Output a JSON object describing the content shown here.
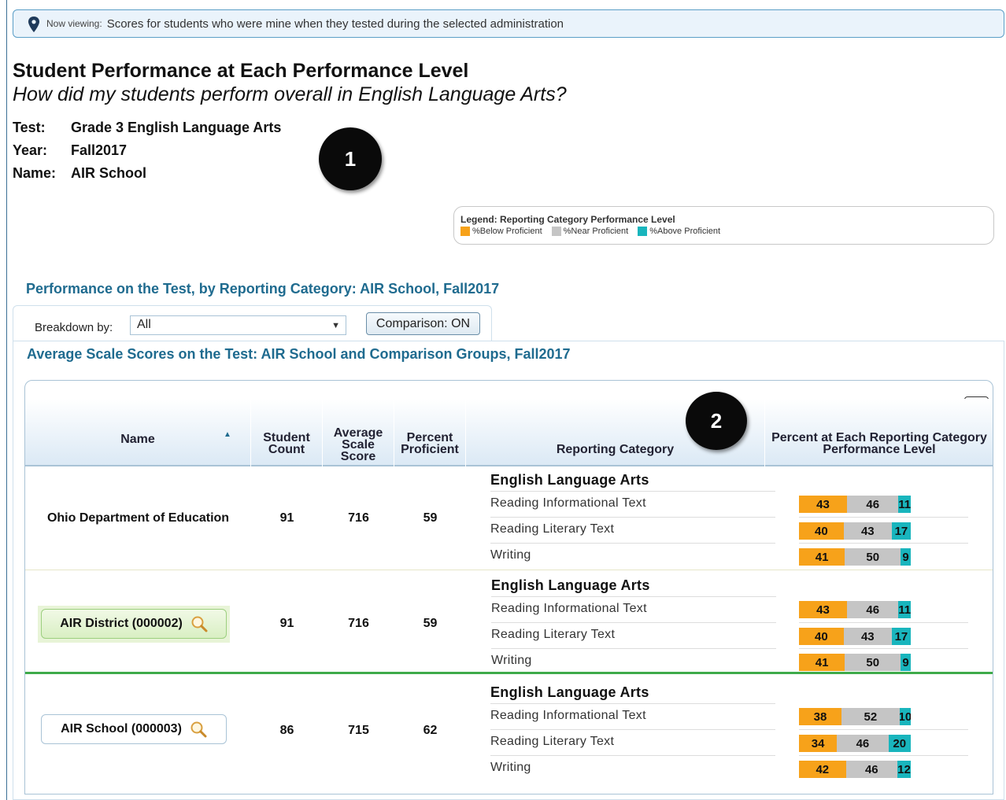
{
  "banner": {
    "label": "Now viewing:",
    "text": "Scores for students who were mine when they tested during the selected administration"
  },
  "report": {
    "title": "Student Performance at Each Performance Level",
    "subtitle": "How did my students perform overall in English Language Arts?",
    "meta": [
      {
        "key": "Test:",
        "value": "Grade 3 English Language Arts"
      },
      {
        "key": "Year:",
        "value": "Fall2017"
      },
      {
        "key": "Name:",
        "value": "AIR School"
      }
    ]
  },
  "callouts": {
    "one": "1",
    "two": "2"
  },
  "legend": {
    "title": "Legend: Reporting Category Performance Level",
    "items": [
      {
        "label": "%Below Proficient",
        "color": "#f7a21a"
      },
      {
        "label": "%Near Proficient",
        "color": "#c5c5c5"
      },
      {
        "label": "%Above Proficient",
        "color": "#19b5bd"
      }
    ]
  },
  "section1": {
    "title": "Performance on the Test, by Reporting Category: AIR School, Fall2017"
  },
  "controls": {
    "breakdown_label": "Breakdown by:",
    "breakdown_value": "All",
    "comparison_button": "Comparison: ON"
  },
  "section2": {
    "title": "Average Scale Scores on the Test: AIR School and Comparison Groups, Fall2017"
  },
  "table": {
    "headers": {
      "name": "Name",
      "count": "Student Count",
      "avg": "Average Scale Score",
      "pct": "Percent Proficient",
      "rc": "Reporting Category",
      "pl": "Percent at Each Reporting Category Performance Level"
    },
    "rows": [
      {
        "name": "Ohio Department of Education",
        "count": "91",
        "avg": "716",
        "pct": "59",
        "subject": "English Language Arts",
        "categories": [
          {
            "label": "Reading Informational Text",
            "below": 43,
            "near": 46,
            "above": 11
          },
          {
            "label": "Reading Literary Text",
            "below": 40,
            "near": 43,
            "above": 17
          },
          {
            "label": "Writing",
            "below": 41,
            "near": 50,
            "above": 9
          }
        ]
      },
      {
        "name": "AIR District (000002)",
        "count": "91",
        "avg": "716",
        "pct": "59",
        "subject": "English Language Arts",
        "categories": [
          {
            "label": "Reading Informational Text",
            "below": 43,
            "near": 46,
            "above": 11
          },
          {
            "label": "Reading Literary Text",
            "below": 40,
            "near": 43,
            "above": 17
          },
          {
            "label": "Writing",
            "below": 41,
            "near": 50,
            "above": 9
          }
        ]
      },
      {
        "name": "AIR School (000003)",
        "count": "86",
        "avg": "715",
        "pct": "62",
        "subject": "English Language Arts",
        "categories": [
          {
            "label": "Reading Informational Text",
            "below": 38,
            "near": 52,
            "above": 10
          },
          {
            "label": "Reading Literary Text",
            "below": 34,
            "near": 46,
            "above": 20
          },
          {
            "label": "Writing",
            "below": 42,
            "near": 46,
            "above": 12
          }
        ]
      }
    ]
  }
}
